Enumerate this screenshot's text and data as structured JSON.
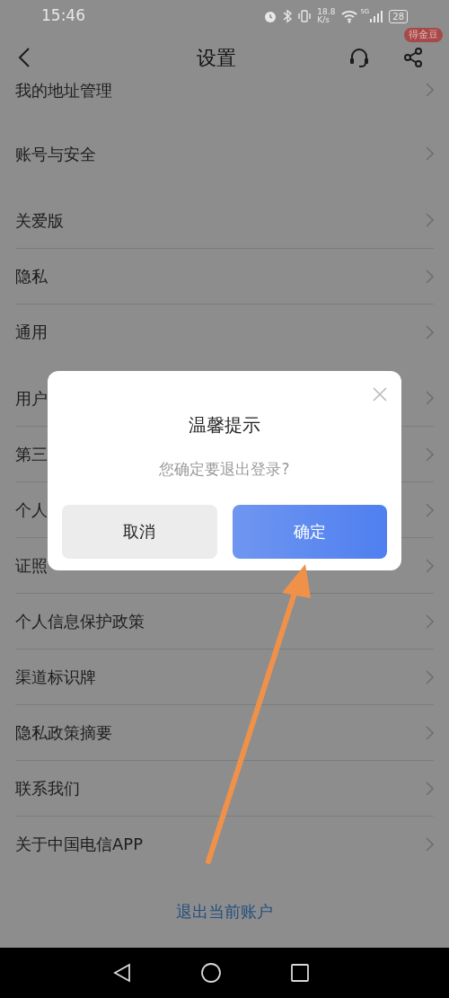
{
  "status_bar": {
    "time": "15:46",
    "speed_value": "18.8",
    "speed_unit": "K/s",
    "network": "5G",
    "battery": "28"
  },
  "header": {
    "title": "设置",
    "badge": "得金豆"
  },
  "sections": [
    {
      "items": [
        {
          "label": "我的地址管理"
        }
      ]
    },
    {
      "items": [
        {
          "label": "账号与安全"
        }
      ]
    },
    {
      "items": [
        {
          "label": "关爱版"
        },
        {
          "label": "隐私"
        },
        {
          "label": "通用"
        }
      ]
    },
    {
      "items": [
        {
          "label": "用户"
        },
        {
          "label": "第三"
        },
        {
          "label": "个人"
        },
        {
          "label": "证照"
        },
        {
          "label": "个人信息保护政策"
        },
        {
          "label": "渠道标识牌"
        },
        {
          "label": "隐私政策摘要"
        },
        {
          "label": "联系我们"
        },
        {
          "label": "关于中国电信APP"
        }
      ]
    }
  ],
  "logout": "退出当前账户",
  "dialog": {
    "title": "温馨提示",
    "message": "您确定要退出登录?",
    "buttons": [
      {
        "label": "取消",
        "kind": "secondary"
      },
      {
        "label": "确定",
        "kind": "primary"
      }
    ]
  }
}
